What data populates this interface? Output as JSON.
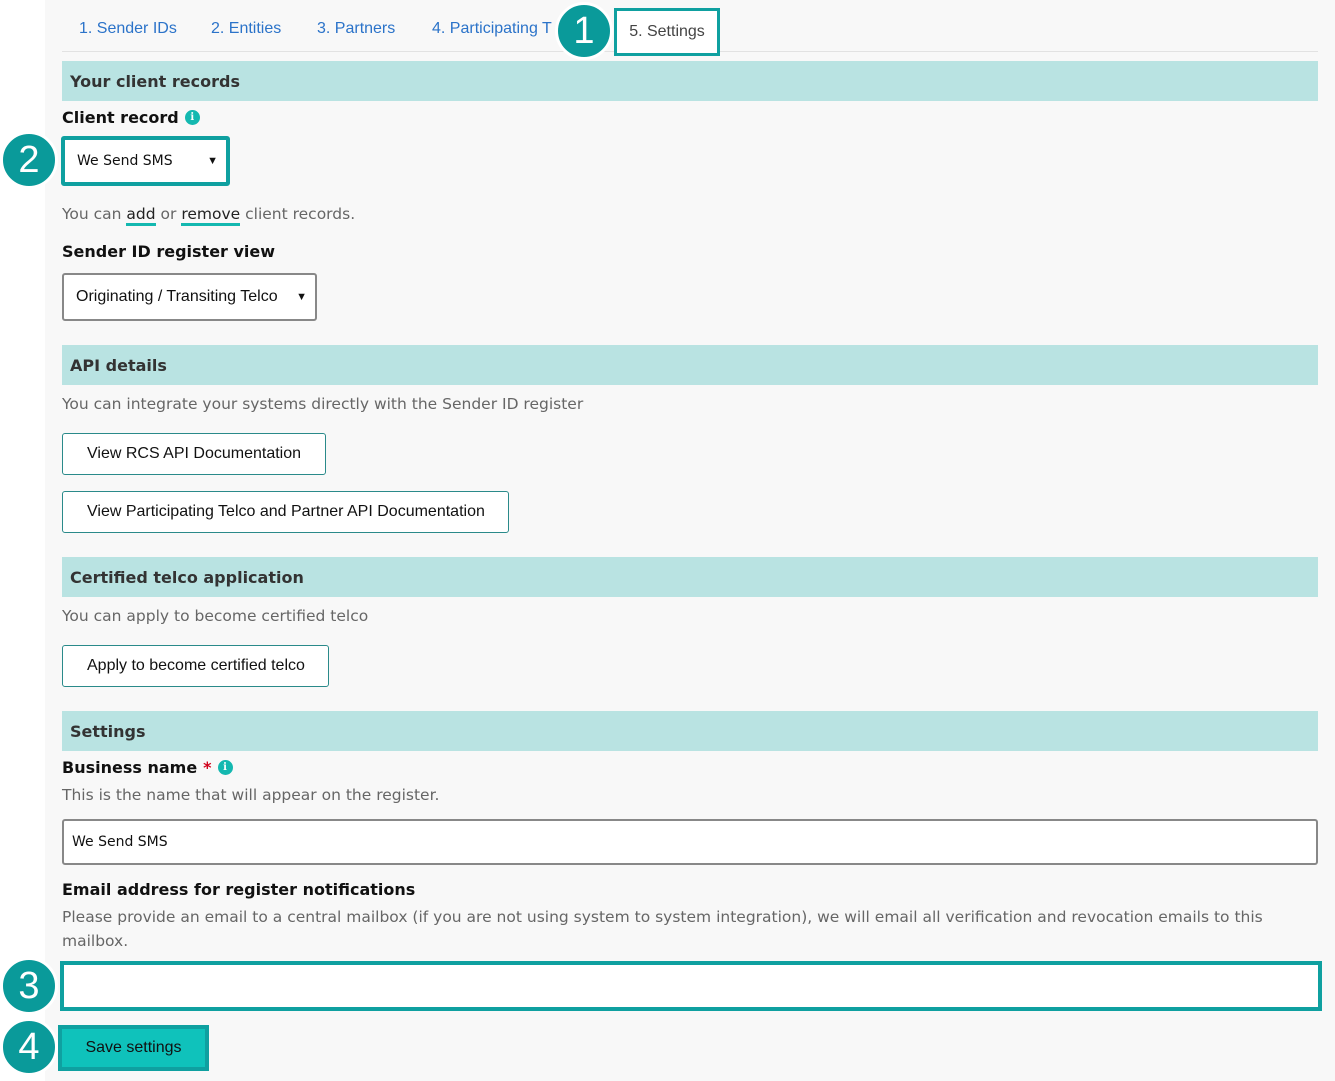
{
  "tabs": {
    "items": [
      "1. Sender IDs",
      "2. Entities",
      "3. Partners",
      "4. Participating T"
    ],
    "active": "5. Settings"
  },
  "sections": {
    "client_records": "Your client records",
    "api_details": "API details",
    "certified": "Certified telco application",
    "settings": "Settings"
  },
  "client_record": {
    "label": "Client record",
    "value": "We Send SMS",
    "help_prefix": "You can ",
    "add_link": "add",
    "or_text": " or ",
    "remove_link": "remove",
    "help_suffix": " client records."
  },
  "register_view": {
    "label": "Sender ID register view",
    "value": "Originating / Transiting Telco"
  },
  "api": {
    "description": "You can integrate your systems directly with the Sender ID register",
    "rcs_button": "View RCS API Documentation",
    "telco_button": "View Participating Telco and Partner API Documentation"
  },
  "certified": {
    "description": "You can apply to become certified telco",
    "apply_button": "Apply to become certified telco"
  },
  "business_name": {
    "label": "Business name",
    "required": "*",
    "help": "This is the name that will appear on the register.",
    "value": "We Send SMS"
  },
  "email": {
    "label": "Email address for register notifications",
    "help_line1": "Please provide an email to a central mailbox (if you are not using system to system integration), we will email all verification and revocation emails to this",
    "help_line2": "mailbox.",
    "value": ""
  },
  "save_label": "Save settings",
  "steps": [
    "1",
    "2",
    "3",
    "4"
  ],
  "icons": {
    "info": "i",
    "chevron": "⌄"
  },
  "colors": {
    "accent": "#0fa0a0",
    "section_bg": "#b9e3e2",
    "link": "#2b73c9",
    "save_bg": "#0fc2bb"
  }
}
